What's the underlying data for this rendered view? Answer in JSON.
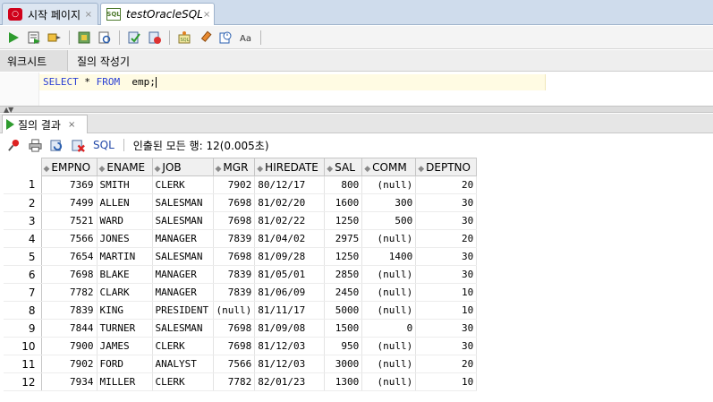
{
  "tabs": {
    "start_page": "시작 페이지",
    "worksheet": "testOracleSQL",
    "close": "×"
  },
  "subtabs": {
    "worksheet": "워크시트",
    "query_builder": "질의 작성기"
  },
  "editor": {
    "code_select": "SELECT",
    "code_star": " * ",
    "code_from": "FROM",
    "code_table": "  emp;"
  },
  "result_tab": {
    "label": "질의 결과",
    "close": "×"
  },
  "result_toolbar": {
    "sql_link": "SQL",
    "status": "인출된 모든 행: 12(0.005초)"
  },
  "icons": {
    "toolbar": [
      "run-statement-icon",
      "run-script-icon",
      "autotrace-icon",
      "explain-plan-icon",
      "sql-tuning-icon",
      "commit-icon",
      "rollback-icon",
      "unshared-sql-icon",
      "clear-icon",
      "history-icon",
      "format-icon"
    ],
    "result_toolbar": [
      "pin-icon",
      "print-icon",
      "refresh-icon",
      "delete-icon"
    ]
  },
  "colors": {
    "keyword": "#2a3fd4",
    "run_green": "#2e9b2e",
    "link_blue": "#2248a8"
  },
  "table": {
    "columns": [
      "EMPNO",
      "ENAME",
      "JOB",
      "MGR",
      "HIREDATE",
      "SAL",
      "COMM",
      "DEPTNO"
    ],
    "rows": [
      [
        "1",
        "7369",
        "SMITH",
        "CLERK",
        "7902",
        "80/12/17",
        "800",
        "(null)",
        "20"
      ],
      [
        "2",
        "7499",
        "ALLEN",
        "SALESMAN",
        "7698",
        "81/02/20",
        "1600",
        "300",
        "30"
      ],
      [
        "3",
        "7521",
        "WARD",
        "SALESMAN",
        "7698",
        "81/02/22",
        "1250",
        "500",
        "30"
      ],
      [
        "4",
        "7566",
        "JONES",
        "MANAGER",
        "7839",
        "81/04/02",
        "2975",
        "(null)",
        "20"
      ],
      [
        "5",
        "7654",
        "MARTIN",
        "SALESMAN",
        "7698",
        "81/09/28",
        "1250",
        "1400",
        "30"
      ],
      [
        "6",
        "7698",
        "BLAKE",
        "MANAGER",
        "7839",
        "81/05/01",
        "2850",
        "(null)",
        "30"
      ],
      [
        "7",
        "7782",
        "CLARK",
        "MANAGER",
        "7839",
        "81/06/09",
        "2450",
        "(null)",
        "10"
      ],
      [
        "8",
        "7839",
        "KING",
        "PRESIDENT",
        "(null)",
        "81/11/17",
        "5000",
        "(null)",
        "10"
      ],
      [
        "9",
        "7844",
        "TURNER",
        "SALESMAN",
        "7698",
        "81/09/08",
        "1500",
        "0",
        "30"
      ],
      [
        "10",
        "7900",
        "JAMES",
        "CLERK",
        "7698",
        "81/12/03",
        "950",
        "(null)",
        "30"
      ],
      [
        "11",
        "7902",
        "FORD",
        "ANALYST",
        "7566",
        "81/12/03",
        "3000",
        "(null)",
        "20"
      ],
      [
        "12",
        "7934",
        "MILLER",
        "CLERK",
        "7782",
        "82/01/23",
        "1300",
        "(null)",
        "10"
      ]
    ]
  }
}
